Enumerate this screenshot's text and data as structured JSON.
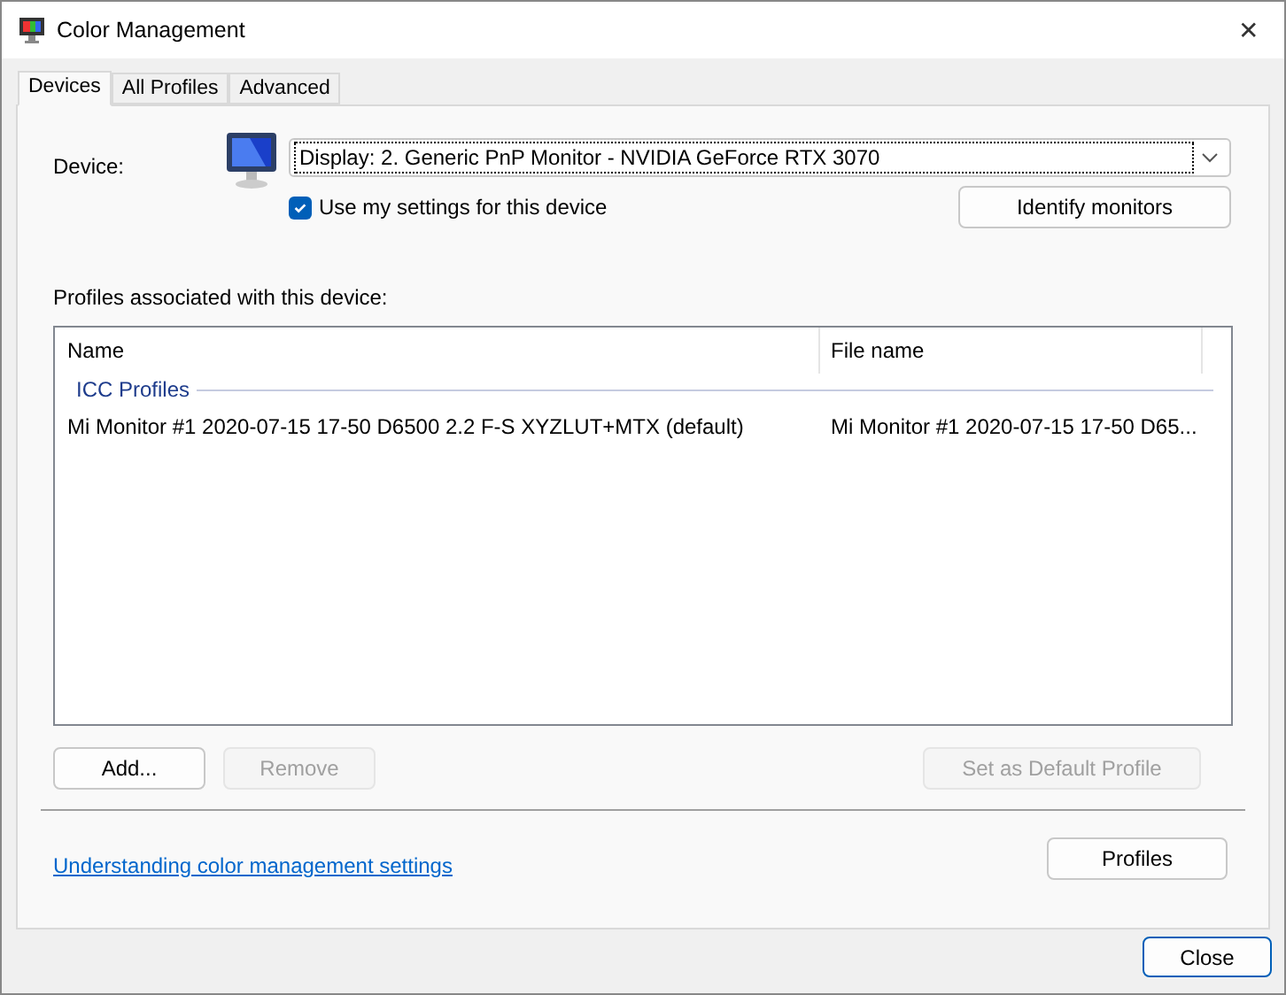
{
  "window": {
    "title": "Color Management",
    "close": "✕"
  },
  "tabs": [
    {
      "label": "Devices",
      "selected": true
    },
    {
      "label": "All Profiles",
      "selected": false
    },
    {
      "label": "Advanced",
      "selected": false
    }
  ],
  "device": {
    "label": "Device:",
    "value": "Display: 2. Generic PnP Monitor - NVIDIA GeForce RTX 3070"
  },
  "use_my_settings": {
    "label": "Use my settings for this device",
    "checked": true
  },
  "identify_button": "Identify monitors",
  "profiles": {
    "label": "Profiles associated with this device:",
    "columns": [
      "Name",
      "File name"
    ],
    "group": "ICC Profiles",
    "rows": [
      {
        "name": "Mi Monitor #1 2020-07-15 17-50 D6500 2.2 F-S XYZLUT+MTX (default)",
        "file": "Mi Monitor #1 2020-07-15 17-50 D65..."
      }
    ]
  },
  "actions": [
    {
      "label": "Add...",
      "disabled": false
    },
    {
      "label": "Remove",
      "disabled": true
    },
    {
      "label": "Set as Default Profile",
      "disabled": true
    }
  ],
  "link": "Understanding color management settings",
  "profiles_button": "Profiles",
  "close_button": "Close"
}
